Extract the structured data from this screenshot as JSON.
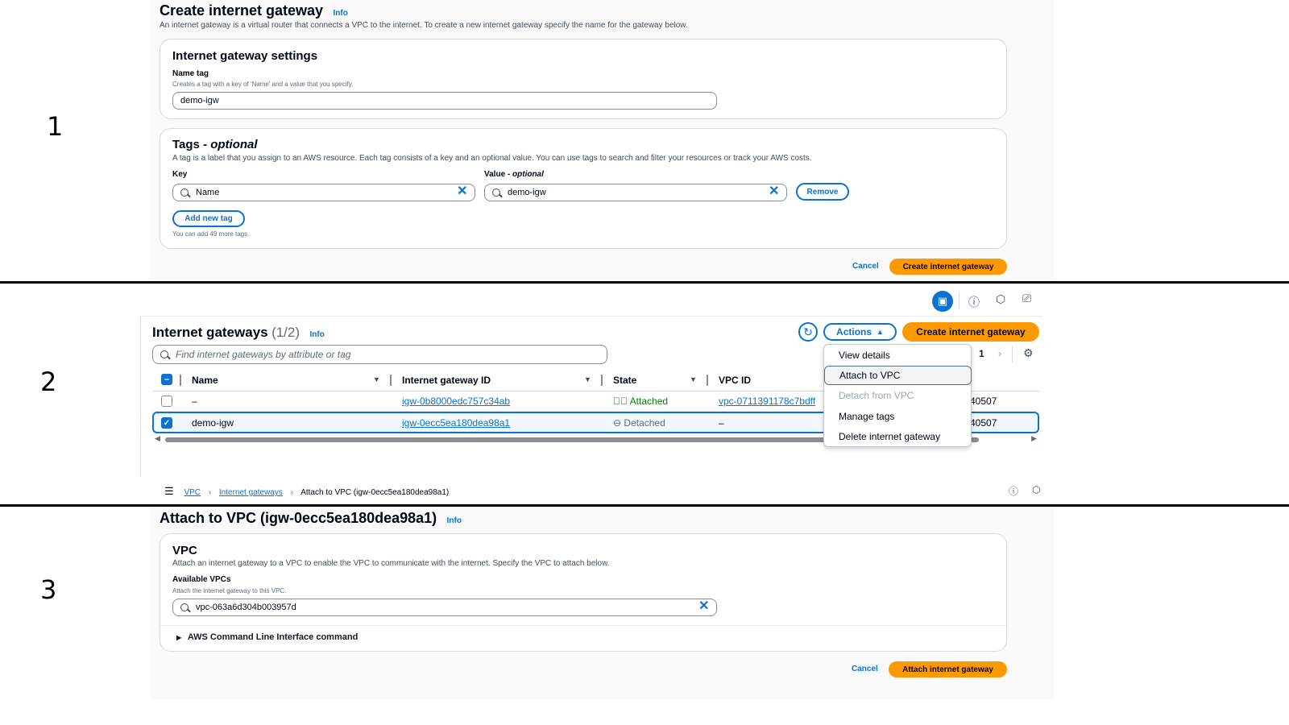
{
  "steps": [
    "1",
    "2",
    "3"
  ],
  "section1": {
    "title": "Create internet gateway",
    "info": "Info",
    "description": "An internet gateway is a virtual router that connects a VPC to the internet. To create a new internet gateway specify the name for the gateway below.",
    "settings": {
      "title": "Internet gateway settings",
      "name_label": "Name tag",
      "name_hint": "Creates a tag with a key of 'Name' and a value that you specify.",
      "name_value": "demo-igw"
    },
    "tags": {
      "title_main": "Tags - ",
      "title_optional": "optional",
      "description": "A tag is a label that you assign to an AWS resource. Each tag consists of a key and an optional value. You can use tags to search and filter your resources or track your AWS costs.",
      "key_label": "Key",
      "value_label_main": "Value - ",
      "value_label_optional": "optional",
      "key_value": "Name",
      "value_value": "demo-igw",
      "remove_label": "Remove",
      "add_label": "Add new tag",
      "limit_hint": "You can add 49 more tags."
    },
    "cancel_label": "Cancel",
    "submit_label": "Create internet gateway"
  },
  "section2": {
    "title": "Internet gateways",
    "count": "(1/2)",
    "info": "Info",
    "actions_label": "Actions",
    "create_label": "Create internet gateway",
    "search_placeholder": "Find internet gateways by attribute or tag",
    "page_number": "1",
    "columns": [
      "Name",
      "Internet gateway ID",
      "State",
      "VPC ID"
    ],
    "rows": [
      {
        "name": "–",
        "id": "igw-0b8000edc757c34ab",
        "state": "Attached",
        "vpc": "vpc-0711391178c7bdff",
        "owner": "40507",
        "checked": false
      },
      {
        "name": "demo-igw",
        "id": "igw-0ecc5ea180dea98a1",
        "state": "Detached",
        "vpc": "–",
        "owner": "40507",
        "checked": true
      }
    ],
    "menu": [
      "View details",
      "Attach to VPC",
      "Detach from VPC",
      "Manage tags",
      "Delete internet gateway"
    ],
    "breadcrumb": [
      "VPC",
      "Internet gateways",
      "Attach to VPC (igw-0ecc5ea180dea98a1)"
    ]
  },
  "section3": {
    "title": "Attach to VPC (igw-0ecc5ea180dea98a1)",
    "info": "Info",
    "card_title": "VPC",
    "card_description": "Attach an internet gateway to a VPC to enable the VPC to communicate with the internet. Specify the VPC to attach below.",
    "vpcs_label": "Available VPCs",
    "vpcs_hint": "Attach the internet gateway to this VPC.",
    "vpc_value": "vpc-063a6d304b003957d",
    "cli_label": "AWS Command Line Interface command",
    "cancel_label": "Cancel",
    "submit_label": "Attach internet gateway"
  },
  "colors": {
    "primary": "#ff9900",
    "link": "#0972d3",
    "success": "#037f0c",
    "muted": "#5f6b7a"
  }
}
